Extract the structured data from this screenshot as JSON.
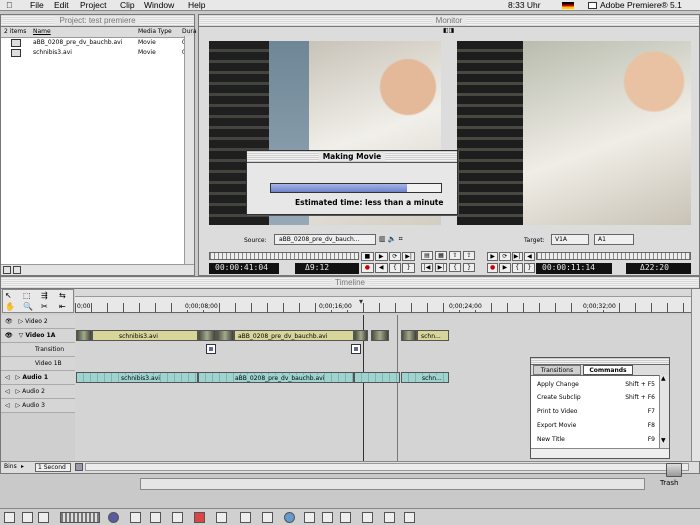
{
  "menubar": {
    "items": [
      "File",
      "Edit",
      "Project",
      "Clip",
      "Window",
      "Help"
    ],
    "clock": "8:33 Uhr",
    "app_name": "Adobe Premiere® 5.1"
  },
  "project": {
    "title": "Project: test premiere",
    "count": "2 items",
    "columns": [
      "Name",
      "Media Type",
      "Dura"
    ],
    "rows": [
      {
        "name": "aBB_0208_pre_dv_bauchb.avi",
        "type": "Movie",
        "dur": "02"
      },
      {
        "name": "schnibis3.avi",
        "type": "Movie",
        "dur": "02"
      }
    ]
  },
  "monitor": {
    "title": "Monitor",
    "source_label": "Source:",
    "source_value": "aBB_0208_pre_dv_bauch...",
    "target_label": "Target:",
    "target_v": "V1A",
    "target_a": "A1",
    "tc_source": "00:00:41:04",
    "tc_source_dur": "Δ9:12",
    "tc_program": "00:00:11:14",
    "tc_program_dur": "Δ22:20"
  },
  "dialog": {
    "title": "Making Movie",
    "status": "Estimated time: less than a minute",
    "progress": 0.8
  },
  "timeline": {
    "title": "Timeline",
    "ruler": [
      "0;00",
      "0;00;08;00",
      "0;00;16;00",
      "0;00;24;00",
      "0;00;32;00"
    ],
    "tracks": [
      "Video 2",
      "Video 1A",
      "Transition",
      "Video 1B",
      "Audio 1",
      "Audio 2",
      "Audio 3"
    ],
    "video_clips": [
      "schnibis3.avi",
      "aBB_0208_pre_dv_bauchb.avi",
      "schn..."
    ],
    "audio_clips": [
      "schnibis3.avi",
      "aBB_0208_pre_dv_bauchb.avi",
      "schn..."
    ],
    "bins_label": "Bins",
    "duration_label": "1 Second"
  },
  "commands": {
    "tabs": [
      "Transitions",
      "Commands"
    ],
    "items": [
      {
        "name": "Apply Change",
        "key": "Shift + F5"
      },
      {
        "name": "Create Subclip",
        "key": "Shift + F6"
      },
      {
        "name": "Print to Video",
        "key": "F7"
      },
      {
        "name": "Export Movie",
        "key": "F8"
      },
      {
        "name": "New Title",
        "key": "F9"
      }
    ]
  },
  "desktop": {
    "trash": "Trash"
  }
}
